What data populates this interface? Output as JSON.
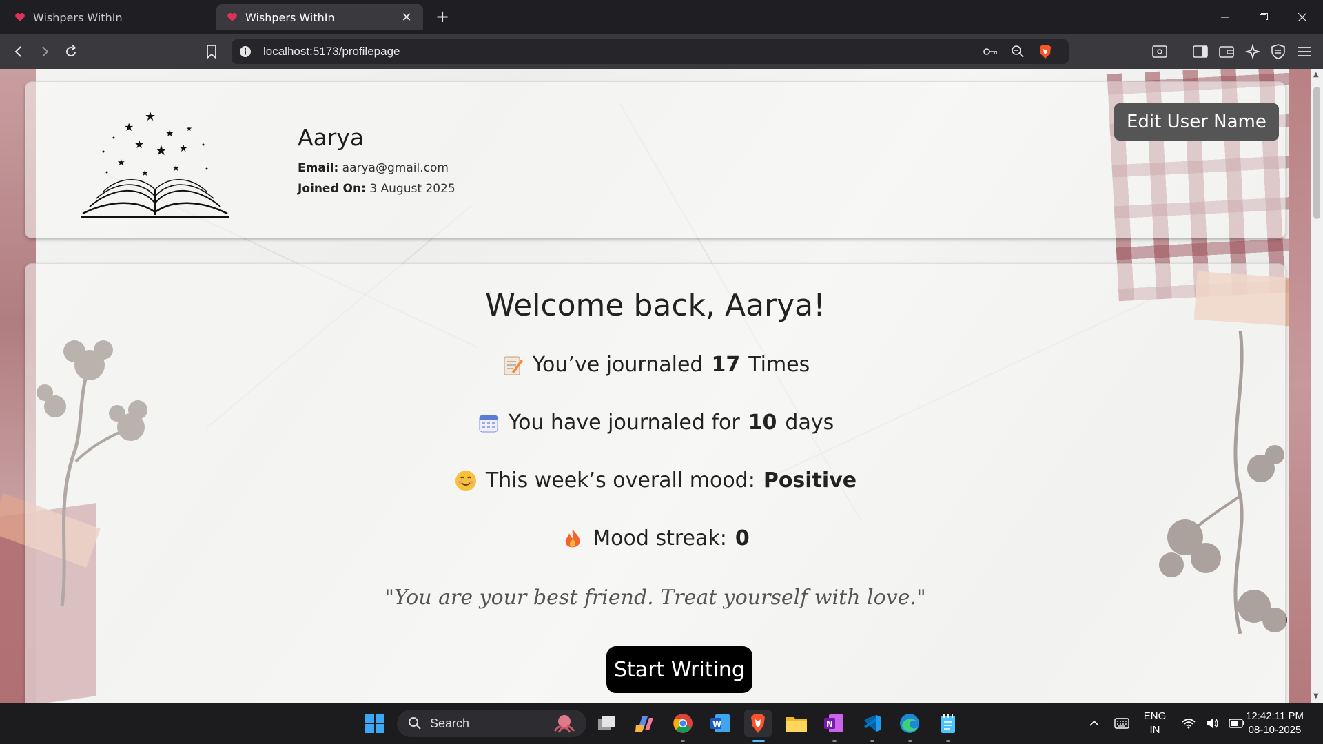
{
  "browser": {
    "tabs": [
      {
        "title": "Wishpers WithIn",
        "active": false
      },
      {
        "title": "Wishpers WithIn",
        "active": true
      }
    ],
    "url": "localhost:5173/profilepage"
  },
  "profile": {
    "name": "Aarya",
    "email_label": "Email:",
    "email": "aarya@gmail.com",
    "joined_label": "Joined On:",
    "joined": "3 August 2025",
    "edit_button": "Edit User Name"
  },
  "dashboard": {
    "welcome": "Welcome back, Aarya!",
    "journaled_prefix": "You’ve journaled",
    "journaled_count": "17",
    "journaled_suffix": "Times",
    "days_prefix": "You have journaled for",
    "days_count": "10",
    "days_suffix": "days",
    "mood_prefix": "This week’s overall mood:",
    "mood_value": "Positive",
    "streak_prefix": "Mood streak:",
    "streak_value": "0",
    "quote": "\"You are your best friend. Treat yourself with love.\"",
    "start_button": "Start Writing"
  },
  "taskbar": {
    "search_label": "Search",
    "lang_line1": "ENG",
    "lang_line2": "IN",
    "time": "12:42:11 PM",
    "date": "08-10-2025"
  },
  "colors": {
    "accent": "#4cc2ff",
    "brave_orange": "#fb542b",
    "edit_button_bg": "#555555",
    "start_button_bg": "#000000"
  }
}
